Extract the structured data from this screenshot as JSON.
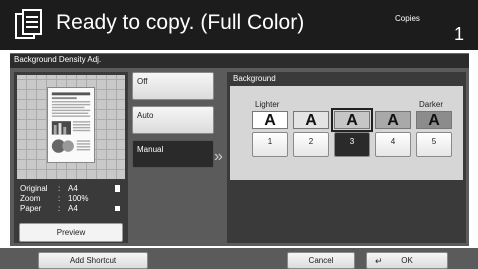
{
  "header": {
    "status": "Ready to copy. (Full Color)",
    "copies_label": "Copies",
    "copies_value": "1",
    "icon": "copy-document-icon"
  },
  "title": "Background Density Adj.",
  "preview": {
    "info": [
      {
        "label": "Original",
        "value": "A4",
        "icon": "portrait-page-icon"
      },
      {
        "label": "Zoom",
        "value": "100%"
      },
      {
        "label": "Paper",
        "value": "A4",
        "icon": "paper-tray-icon"
      }
    ],
    "button_label": "Preview"
  },
  "modes": {
    "off": "Off",
    "auto": "Auto",
    "manual": "Manual",
    "selected": "Manual"
  },
  "density": {
    "heading": "Background",
    "lighter": "Lighter",
    "darker": "Darker",
    "sample_glyph": "A",
    "samples": [
      "A",
      "A",
      "A",
      "A",
      "A"
    ],
    "levels": [
      "1",
      "2",
      "3",
      "4",
      "5"
    ],
    "selected_level": "3"
  },
  "bottom": {
    "add_shortcut": "Add Shortcut",
    "cancel": "Cancel",
    "ok": "OK",
    "ok_icon": "enter-arrow-icon"
  }
}
